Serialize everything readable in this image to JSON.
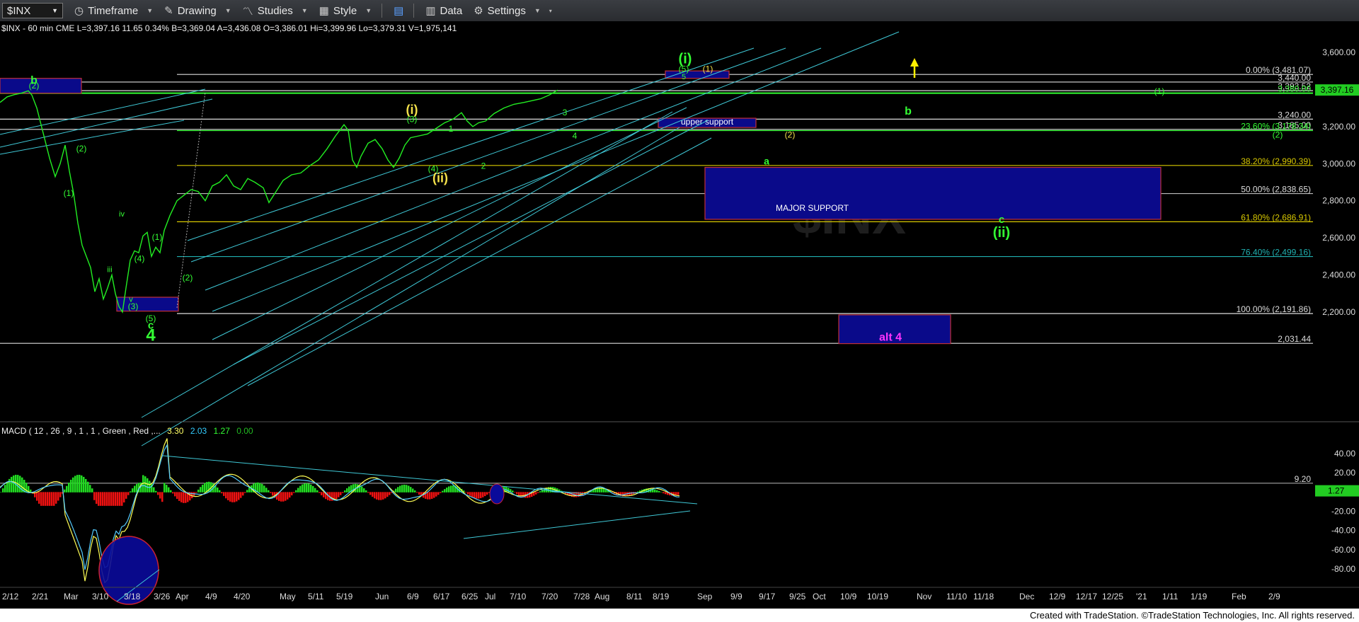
{
  "toolbar": {
    "symbol": "$INX",
    "timeframe": "Timeframe",
    "drawing": "Drawing",
    "studies": "Studies",
    "style": "Style",
    "data": "Data",
    "settings": "Settings"
  },
  "header": {
    "quote": "$INX - 60 min CME  L=3,397.16  11.65  0.34%  B=3,369.04  A=3,436.08  O=3,386.01  Hi=3,399.96  Lo=3,379.31  V=1,975,141"
  },
  "macd_header": {
    "label": "MACD ( 12 , 26 , 9 , 1 , 1 , Green , Red ,...",
    "v1": "3.30",
    "v2": "2.03",
    "v3": "1.27",
    "v4": "0.00",
    "c1": "#ffff66",
    "c2": "#33ccff",
    "c3": "#33ff33",
    "c4": "#22bb22"
  },
  "chart_data": {
    "type": "line",
    "title": "$INX - 60 min",
    "price_axis": {
      "ticks": [
        3600,
        3400,
        3200,
        3000,
        2800,
        2600,
        2400,
        2200
      ],
      "tick_labels": [
        "3,600.00",
        "3,400.00",
        "3,200.00",
        "3,000.00",
        "2,800.00",
        "2,600.00",
        "2,400.00",
        "2,200.00"
      ],
      "ylim": [
        2000,
        3680
      ],
      "last": {
        "value": 3397.16,
        "label": "3,397.16",
        "color": "#33ff33"
      }
    },
    "x_axis_labels": [
      "2/12",
      "2/21",
      "Mar",
      "3/10",
      "3/18",
      "3/26",
      "Apr",
      "4/9",
      "4/20",
      "May",
      "5/11",
      "5/19",
      "Jun",
      "6/9",
      "6/17",
      "6/25",
      "Jul",
      "7/10",
      "7/20",
      "7/28",
      "Aug",
      "8/11",
      "8/19",
      "Sep",
      "9/9",
      "9/17",
      "9/25",
      "Oct",
      "10/9",
      "10/19",
      "Nov",
      "11/10",
      "11/18",
      "Dec",
      "12/9",
      "12/17",
      "12/25",
      "'21",
      "1/11",
      "1/19",
      "Feb",
      "2/9"
    ],
    "price_series": [
      [
        0,
        3330
      ],
      [
        10,
        3360
      ],
      [
        20,
        3372
      ],
      [
        30,
        3380
      ],
      [
        40,
        3393
      ],
      [
        45,
        3370
      ],
      [
        52,
        3300
      ],
      [
        60,
        3180
      ],
      [
        70,
        3030
      ],
      [
        78,
        2930
      ],
      [
        85,
        3000
      ],
      [
        92,
        3100
      ],
      [
        98,
        2960
      ],
      [
        104,
        2840
      ],
      [
        110,
        2680
      ],
      [
        116,
        2560
      ],
      [
        122,
        2500
      ],
      [
        128,
        2440
      ],
      [
        134,
        2310
      ],
      [
        140,
        2380
      ],
      [
        146,
        2270
      ],
      [
        152,
        2330
      ],
      [
        158,
        2400
      ],
      [
        163,
        2300
      ],
      [
        168,
        2230
      ],
      [
        173,
        2200
      ],
      [
        178,
        2330
      ],
      [
        184,
        2480
      ],
      [
        190,
        2530
      ],
      [
        196,
        2520
      ],
      [
        202,
        2610
      ],
      [
        208,
        2630
      ],
      [
        214,
        2500
      ],
      [
        220,
        2550
      ],
      [
        226,
        2520
      ],
      [
        232,
        2640
      ],
      [
        240,
        2720
      ],
      [
        250,
        2800
      ],
      [
        260,
        2830
      ],
      [
        270,
        2860
      ],
      [
        280,
        2850
      ],
      [
        290,
        2800
      ],
      [
        300,
        2880
      ],
      [
        310,
        2900
      ],
      [
        320,
        2940
      ],
      [
        330,
        2880
      ],
      [
        340,
        2860
      ],
      [
        350,
        2920
      ],
      [
        360,
        2900
      ],
      [
        372,
        2870
      ],
      [
        380,
        2790
      ],
      [
        390,
        2850
      ],
      [
        400,
        2910
      ],
      [
        412,
        2940
      ],
      [
        425,
        2950
      ],
      [
        438,
        2990
      ],
      [
        450,
        3020
      ],
      [
        462,
        3080
      ],
      [
        474,
        3150
      ],
      [
        486,
        3210
      ],
      [
        492,
        3180
      ],
      [
        498,
        3020
      ],
      [
        504,
        2980
      ],
      [
        510,
        3040
      ],
      [
        520,
        3110
      ],
      [
        530,
        3130
      ],
      [
        540,
        3080
      ],
      [
        548,
        3020
      ],
      [
        556,
        2980
      ],
      [
        564,
        3030
      ],
      [
        572,
        3100
      ],
      [
        580,
        3140
      ],
      [
        592,
        3150
      ],
      [
        604,
        3160
      ],
      [
        616,
        3190
      ],
      [
        628,
        3220
      ],
      [
        640,
        3240
      ],
      [
        652,
        3275
      ],
      [
        660,
        3230
      ],
      [
        668,
        3200
      ],
      [
        676,
        3220
      ],
      [
        686,
        3230
      ],
      [
        698,
        3270
      ],
      [
        712,
        3300
      ],
      [
        726,
        3320
      ],
      [
        740,
        3330
      ],
      [
        752,
        3340
      ],
      [
        764,
        3350
      ],
      [
        776,
        3370
      ],
      [
        788,
        3397
      ]
    ],
    "levels": [
      {
        "label": "0.00% (3,481.07)",
        "value": 3481.07,
        "color": "#dcdcdc"
      },
      {
        "label": "3,440.00",
        "value": 3440,
        "color": "#dcdcdc"
      },
      {
        "label": "3,393.52",
        "value": 3393.52,
        "color": "#dcdcdc"
      },
      {
        "label": "3,380.00",
        "value": 3380,
        "color": "#33ff33"
      },
      {
        "label": "3,240.00",
        "value": 3240,
        "color": "#dcdcdc"
      },
      {
        "label": "3,185.00",
        "value": 3185,
        "color": "#dcdcdc"
      },
      {
        "label": "23.60% (3,178.34)",
        "value": 3178.34,
        "color": "#33ff33"
      },
      {
        "label": "38.20% (2,990.39)",
        "value": 2990.39,
        "color": "#d8c800"
      },
      {
        "label": "50.00% (2,838.65)",
        "value": 2838.65,
        "color": "#bbbbbb"
      },
      {
        "label": "61.80% (2,686.91)",
        "value": 2686.91,
        "color": "#d8c800"
      },
      {
        "label": "76.40% (2,499.16)",
        "value": 2499.16,
        "color": "#20b0b0"
      },
      {
        "label": "100.00% (2,191.86)",
        "value": 2191.86,
        "color": "#dcdcdc"
      },
      {
        "label": "2,031.44",
        "value": 2031.44,
        "color": "#dcdcdc"
      }
    ],
    "zones": [
      {
        "label": "",
        "top": 3460,
        "bottom": 3380,
        "x0": 0,
        "x1": 115
      },
      {
        "label": "",
        "top": 3500,
        "bottom": 3460,
        "x0": 940,
        "x1": 1030
      },
      {
        "label": "upper support",
        "top": 3245,
        "bottom": 3195,
        "x0": 930,
        "x1": 1068
      },
      {
        "label": "MAJOR SUPPORT",
        "top": 2980,
        "bottom": 2700,
        "x0": 996,
        "x1": 1640
      },
      {
        "label": "",
        "top": 2280,
        "bottom": 2205,
        "x0": 165,
        "x1": 252
      },
      {
        "label": "alt 4",
        "top": 2185,
        "bottom": 2030,
        "x0": 1185,
        "x1": 1343
      }
    ],
    "annotations": [
      {
        "text": "b",
        "x": 48,
        "v": 3430,
        "color": "#33ff33",
        "size": 16
      },
      {
        "text": "(2)",
        "x": 48,
        "v": 3405,
        "color": "#33ff33",
        "size": 12
      },
      {
        "text": "(2)",
        "x": 115,
        "v": 3065,
        "color": "#33ff33",
        "size": 12
      },
      {
        "text": "(1)",
        "x": 97,
        "v": 2825,
        "color": "#33ff33",
        "size": 12
      },
      {
        "text": "iv",
        "x": 172,
        "v": 2715,
        "color": "#33ff33",
        "size": 11
      },
      {
        "text": "iii",
        "x": 155,
        "v": 2415,
        "color": "#33ff33",
        "size": 11
      },
      {
        "text": "(4)",
        "x": 197,
        "v": 2472,
        "color": "#33ff33",
        "size": 12
      },
      {
        "text": "(1)",
        "x": 222,
        "v": 2590,
        "color": "#33ff33",
        "size": 12
      },
      {
        "text": "(2)",
        "x": 265,
        "v": 2370,
        "color": "#33ff33",
        "size": 12
      },
      {
        "text": "v",
        "x": 185,
        "v": 2255,
        "color": "#33ff33",
        "size": 11
      },
      {
        "text": "(3)",
        "x": 188,
        "v": 2215,
        "color": "#33ff33",
        "size": 12
      },
      {
        "text": "(5)",
        "x": 213,
        "v": 2150,
        "color": "#33ff33",
        "size": 12
      },
      {
        "text": "c",
        "x": 213,
        "v": 2110,
        "color": "#33ff33",
        "size": 15
      },
      {
        "text": "4",
        "x": 213,
        "v": 2045,
        "color": "#33ff33",
        "size": 24
      },
      {
        "text": "(i)",
        "x": 582,
        "v": 3268,
        "color": "#f2e04a",
        "size": 18
      },
      {
        "text": "(3)",
        "x": 582,
        "v": 3225,
        "color": "#33ff33",
        "size": 12
      },
      {
        "text": "1",
        "x": 637,
        "v": 3172,
        "color": "#33ff33",
        "size": 12
      },
      {
        "text": "(4)",
        "x": 612,
        "v": 2957,
        "color": "#33ff33",
        "size": 12
      },
      {
        "text": "(ii)",
        "x": 622,
        "v": 2900,
        "color": "#f2e04a",
        "size": 18
      },
      {
        "text": "2",
        "x": 683,
        "v": 2972,
        "color": "#33ff33",
        "size": 12
      },
      {
        "text": "3",
        "x": 798,
        "v": 3260,
        "color": "#33ff33",
        "size": 12
      },
      {
        "text": "4",
        "x": 812,
        "v": 3134,
        "color": "#33ff33",
        "size": 12
      },
      {
        "text": "(i)",
        "x": 968,
        "v": 3540,
        "color": "#33ff33",
        "size": 20
      },
      {
        "text": "(1)",
        "x": 1000,
        "v": 3495,
        "color": "#f2e04a",
        "size": 12
      },
      {
        "text": "(5)",
        "x": 966,
        "v": 3495,
        "color": "#33ff33",
        "size": 12
      },
      {
        "text": "5",
        "x": 966,
        "v": 3455,
        "color": "#33ff33",
        "size": 11
      },
      {
        "text": "(2)",
        "x": 1116,
        "v": 3140,
        "color": "#f2e04a",
        "size": 12
      },
      {
        "text": "a",
        "x": 1083,
        "v": 2995,
        "color": "#33ff33",
        "size": 14
      },
      {
        "text": "b",
        "x": 1283,
        "v": 3265,
        "color": "#33ff33",
        "size": 16
      },
      {
        "text": "(1)",
        "x": 1638,
        "v": 3375,
        "color": "#33ff33",
        "size": 12
      },
      {
        "text": "(2)",
        "x": 1805,
        "v": 3140,
        "color": "#33ff33",
        "size": 12
      },
      {
        "text": "c",
        "x": 1415,
        "v": 2680,
        "color": "#33ff33",
        "size": 15
      },
      {
        "text": "(ii)",
        "x": 1415,
        "v": 2605,
        "color": "#33ff33",
        "size": 20
      }
    ],
    "macd": {
      "tick_labels": [
        "40.00",
        "20.00",
        "-20.00",
        "-40.00",
        "-60.00",
        "-80.00"
      ],
      "ticks": [
        40,
        20,
        -20,
        -40,
        -60,
        -80
      ],
      "ylim": [
        -95,
        52
      ],
      "level": {
        "value": 9.2,
        "label": "9.20"
      },
      "last": {
        "value": 1.27,
        "label": "1.27"
      }
    }
  },
  "footer": {
    "text": "Created with TradeStation. ©TradeStation Technologies, Inc. All rights reserved."
  }
}
